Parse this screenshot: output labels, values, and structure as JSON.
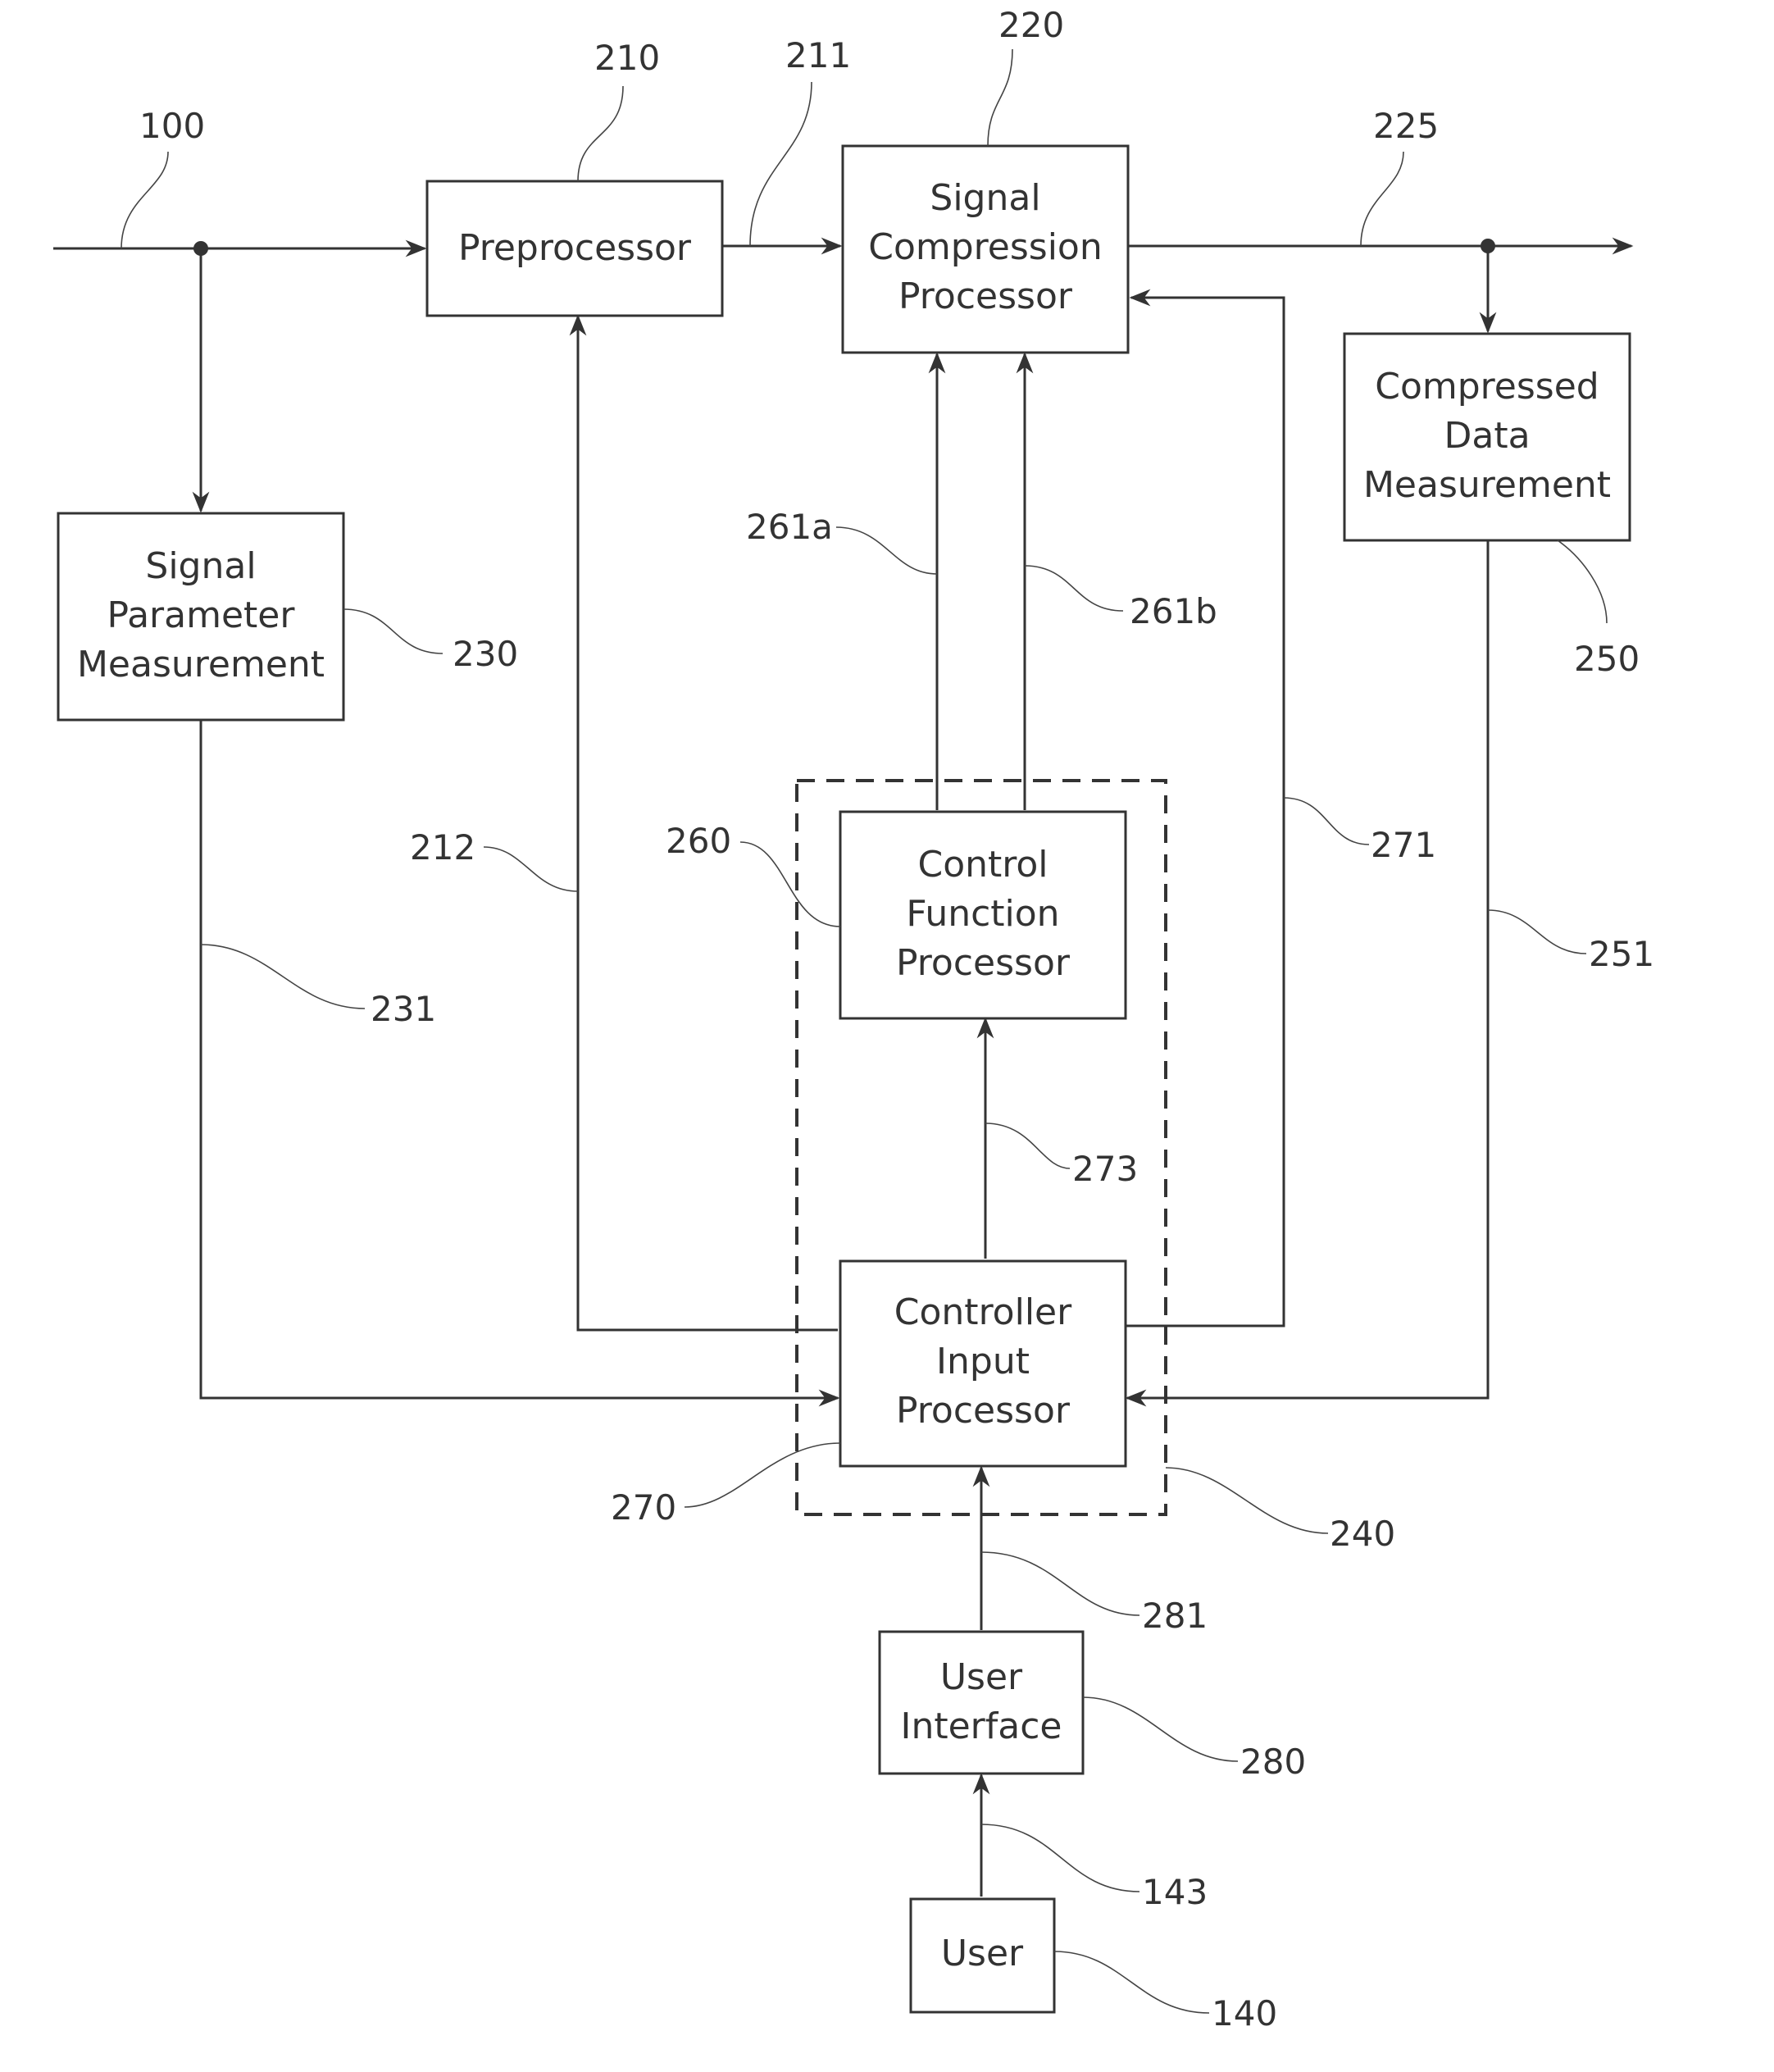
{
  "diagram": {
    "blocks": {
      "preprocessor": {
        "lines": [
          "Preprocessor"
        ],
        "ref": "210"
      },
      "signal_compression": {
        "lines": [
          "Signal",
          "Compression",
          "Processor"
        ],
        "ref": "220"
      },
      "compressed_data": {
        "lines": [
          "Compressed",
          "Data",
          "Measurement"
        ],
        "ref": "250"
      },
      "signal_parameter": {
        "lines": [
          "Signal",
          "Parameter",
          "Measurement"
        ],
        "ref": "230"
      },
      "control_function": {
        "lines": [
          "Control",
          "Function",
          "Processor"
        ],
        "ref": "260"
      },
      "controller_input": {
        "lines": [
          "Controller",
          "Input",
          "Processor"
        ],
        "ref": "270"
      },
      "user_interface": {
        "lines": [
          "User",
          "Interface"
        ],
        "ref": "280"
      },
      "user": {
        "lines": [
          "User"
        ],
        "ref": "140"
      }
    },
    "group_ref": "240",
    "signal_refs": {
      "input": "100",
      "pre_out": "211",
      "comp_out": "225",
      "pre_ctrl": "212",
      "spm_out": "231",
      "cfp_a": "261a",
      "cfp_b": "261b",
      "cip_to_scp": "271",
      "cip_to_cfp": "273",
      "cdm_out": "251",
      "ui_out": "281",
      "user_out": "143"
    }
  }
}
